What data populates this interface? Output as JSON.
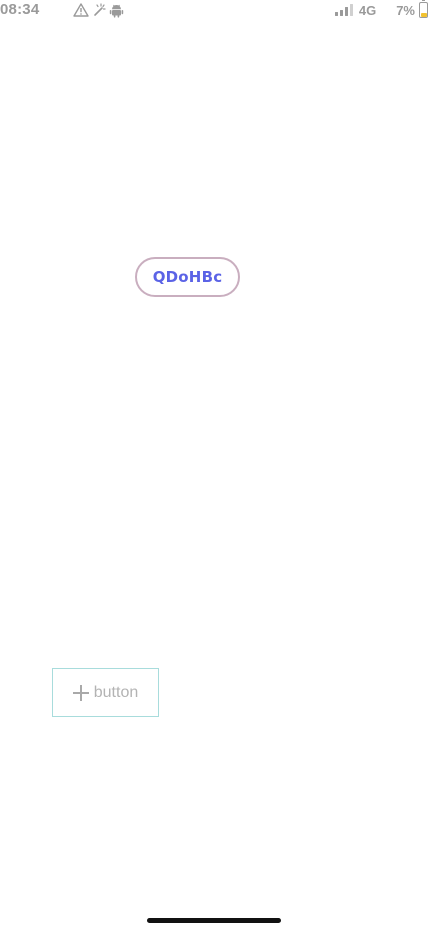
{
  "status_bar": {
    "time": "08:34",
    "left_icons": [
      "warning-icon",
      "magic-wand-icon",
      "android-icon"
    ],
    "network": "4G",
    "battery_percent": "7%",
    "battery_level": 0.07,
    "battery_color": "#f2c230"
  },
  "main": {
    "pill_button_label": "QDoHBc",
    "pill_button_text_color": "#5b63e6",
    "pill_button_border_color": "#c9aebf",
    "add_button_icon": "plus-icon",
    "add_button_label": "button",
    "add_button_border_color": "#a8dcdc"
  }
}
